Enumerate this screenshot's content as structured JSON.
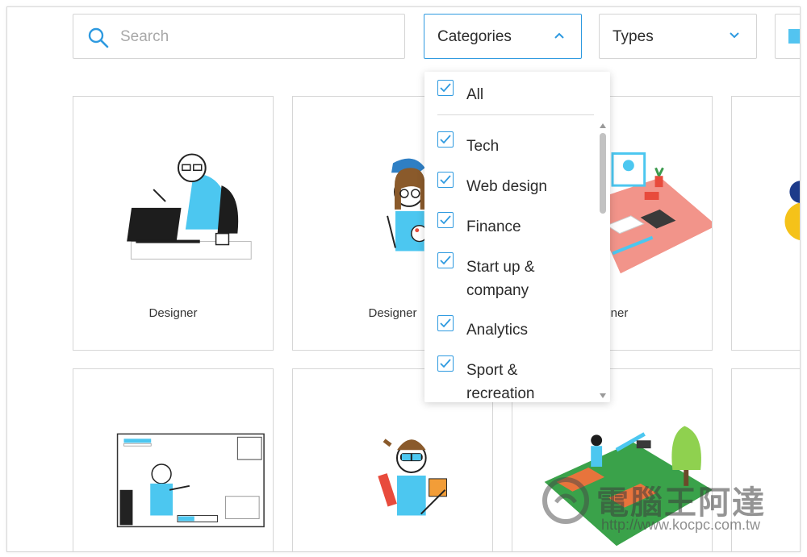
{
  "search": {
    "placeholder": "Search"
  },
  "filters": {
    "categories_label": "Categories",
    "types_label": "Types"
  },
  "categories_menu": {
    "all_label": "All",
    "options": [
      {
        "label": "Tech",
        "checked": true
      },
      {
        "label": "Web design",
        "checked": true
      },
      {
        "label": "Finance",
        "checked": true
      },
      {
        "label": "Start up &\ncompany",
        "checked": true
      },
      {
        "label": "Analytics",
        "checked": true
      },
      {
        "label": "Sport &\nrecreation",
        "checked": true
      }
    ]
  },
  "cards": [
    {
      "name": "Designer"
    },
    {
      "name": "Designer"
    },
    {
      "name": "igner"
    },
    {
      "name": ""
    },
    {
      "name": ""
    },
    {
      "name": ""
    },
    {
      "name": ""
    },
    {
      "name": ""
    }
  ],
  "watermark": {
    "text": "電腦王阿達",
    "url": "http://www.kocpc.com.tw"
  },
  "colors": {
    "accent": "#2e9ae0",
    "cyan": "#53c4f0"
  }
}
